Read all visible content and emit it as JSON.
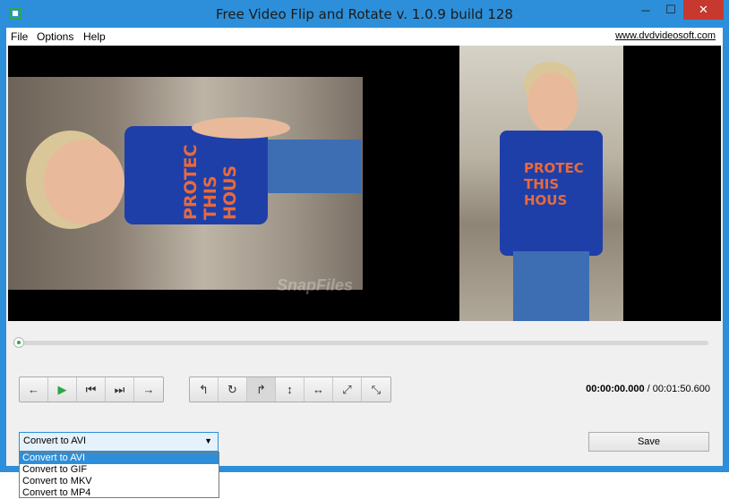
{
  "window": {
    "title": "Free Video Flip and Rotate v. 1.0.9 build 128",
    "controls": {
      "minimize": "─",
      "maximize": "☐",
      "close": "✕"
    }
  },
  "menu": {
    "items": [
      "File",
      "Options",
      "Help"
    ],
    "website": "www.dvdvideosoft.com"
  },
  "video": {
    "left_shirt_text": "PROTEC THIS HOUS",
    "right_shirt_text": "PROTEC THIS HOUS",
    "watermark": "SnapFiles"
  },
  "seek": {
    "position": 0.0
  },
  "playback_buttons": [
    {
      "name": "back-icon",
      "glyph": "←"
    },
    {
      "name": "play-icon",
      "glyph": "▶"
    },
    {
      "name": "prev-frame-icon",
      "glyph": "⏮"
    },
    {
      "name": "next-frame-icon",
      "glyph": "⏭"
    },
    {
      "name": "forward-icon",
      "glyph": "→"
    }
  ],
  "transform_buttons": [
    {
      "name": "rotate-left-icon",
      "glyph": "↰"
    },
    {
      "name": "rotate-180-icon",
      "glyph": "↻"
    },
    {
      "name": "rotate-right-icon",
      "glyph": "↱"
    },
    {
      "name": "flip-vertical-icon",
      "glyph": "↕"
    },
    {
      "name": "flip-horizontal-icon",
      "glyph": "↔"
    },
    {
      "name": "transpose-icon",
      "glyph": "⤢"
    },
    {
      "name": "transverse-icon",
      "glyph": "⤡"
    }
  ],
  "time": {
    "current": "00:00:00.000",
    "separator": "/",
    "total": "00:01:50.600"
  },
  "format": {
    "selected": "Convert to AVI",
    "options": [
      "Convert to AVI",
      "Convert to GIF",
      "Convert to MKV",
      "Convert to MP4"
    ]
  },
  "save_label": "Save",
  "colors": {
    "accent": "#2d8fd9",
    "close_red": "#c7382f",
    "play_green": "#2aa84a"
  }
}
